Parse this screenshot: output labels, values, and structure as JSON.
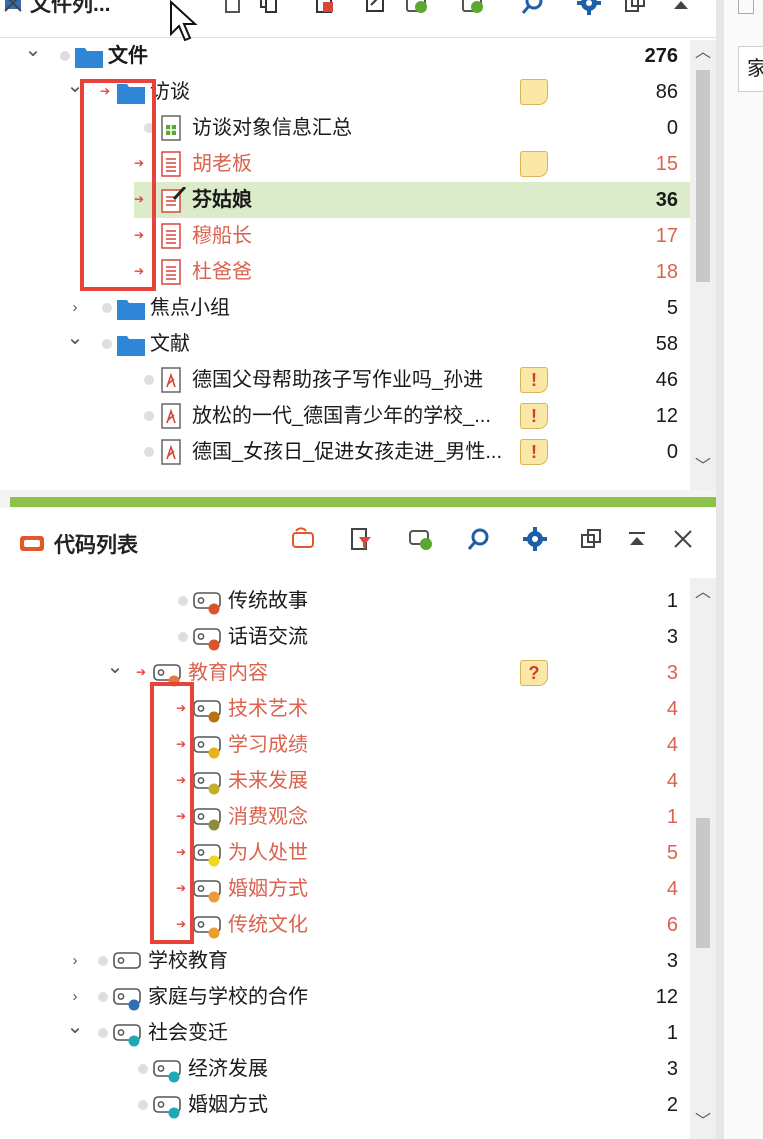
{
  "document_browser": {
    "title": "文件列...",
    "toolbar_icons": [
      "new-document-icon",
      "copy-icon",
      "import-icon",
      "export-icon",
      "add-set-icon",
      "add-group-icon",
      "search-icon",
      "gear-icon",
      "undock-icon",
      "minimize-icon",
      "close-icon"
    ],
    "rows": [
      {
        "label": "文件",
        "count": "276",
        "type": "folder",
        "expand": "v",
        "bold": true
      },
      {
        "label": "访谈",
        "count": "86",
        "type": "folder",
        "expand": "v",
        "arrow": true,
        "memo": "plain"
      },
      {
        "label": "访谈对象信息汇总",
        "count": "0",
        "type": "table"
      },
      {
        "label": "胡老板",
        "count": "15",
        "type": "doc",
        "arrow": true,
        "red": true,
        "memo": "plain"
      },
      {
        "label": "芬姑娘",
        "count": "36",
        "type": "doc-edit",
        "arrow": true,
        "bold": true,
        "selected": true
      },
      {
        "label": "穆船长",
        "count": "17",
        "type": "doc",
        "arrow": true,
        "red": true
      },
      {
        "label": "杜爸爸",
        "count": "18",
        "type": "doc",
        "arrow": true,
        "red": true
      },
      {
        "label": "焦点小组",
        "count": "5",
        "type": "folder",
        "expand": ">"
      },
      {
        "label": "文献",
        "count": "58",
        "type": "folder",
        "expand": "v"
      },
      {
        "label": "德国父母帮助孩子写作业吗_孙进",
        "count": "46",
        "type": "pdf",
        "memo": "alert"
      },
      {
        "label": "放松的一代_德国青少年的学校_...",
        "count": "12",
        "type": "pdf",
        "memo": "alert"
      },
      {
        "label": "德国_女孩日_促进女孩走进_男性...",
        "count": "0",
        "type": "pdf",
        "memo": "alert"
      }
    ],
    "memo_alert_text": "!",
    "memo_question_text": "?"
  },
  "code_system": {
    "title": "代码列表",
    "toolbar_icons": [
      "new-code-icon",
      "filter-icon",
      "add-code-icon",
      "search-icon",
      "gear-icon",
      "undock-icon",
      "minimize-icon",
      "close-icon"
    ],
    "rows": [
      {
        "label": "传统故事",
        "count": "1",
        "color": "#d9532b",
        "depth": 2
      },
      {
        "label": "话语交流",
        "count": "3",
        "color": "#d9532b",
        "depth": 2
      },
      {
        "label": "教育内容",
        "count": "3",
        "color": "#e07b3a",
        "depth": 1,
        "expand": "v",
        "arrow": true,
        "red": true,
        "memo": "question"
      },
      {
        "label": "技术艺术",
        "count": "4",
        "color": "#b8720f",
        "depth": 2,
        "arrow": true,
        "red": true
      },
      {
        "label": "学习成绩",
        "count": "4",
        "color": "#e6b416",
        "depth": 2,
        "arrow": true,
        "red": true
      },
      {
        "label": "未来发展",
        "count": "4",
        "color": "#c2b02a",
        "depth": 2,
        "arrow": true,
        "red": true
      },
      {
        "label": "消费观念",
        "count": "1",
        "color": "#8c8c3a",
        "depth": 2,
        "arrow": true,
        "red": true
      },
      {
        "label": "为人处世",
        "count": "5",
        "color": "#f2d81a",
        "depth": 2,
        "arrow": true,
        "red": true
      },
      {
        "label": "婚姻方式",
        "count": "4",
        "color": "#ef9a3a",
        "depth": 2,
        "arrow": true,
        "red": true
      },
      {
        "label": "传统文化",
        "count": "6",
        "color": "#e8a028",
        "depth": 2,
        "arrow": true,
        "red": true
      },
      {
        "label": "学校教育",
        "count": "3",
        "color": "",
        "depth": 0,
        "expand": ">"
      },
      {
        "label": "家庭与学校的合作",
        "count": "12",
        "color": "#2f6fb3",
        "depth": 0,
        "expand": ">"
      },
      {
        "label": "社会变迁",
        "count": "1",
        "color": "#1fa8b8",
        "depth": 0,
        "expand": "v"
      },
      {
        "label": "经济发展",
        "count": "3",
        "color": "#1fa8b8",
        "depth": 1
      },
      {
        "label": "婚姻方式",
        "count": "2",
        "color": "#1fa8b8",
        "depth": 1
      }
    ]
  },
  "right_pane": {
    "input_text": "家"
  }
}
